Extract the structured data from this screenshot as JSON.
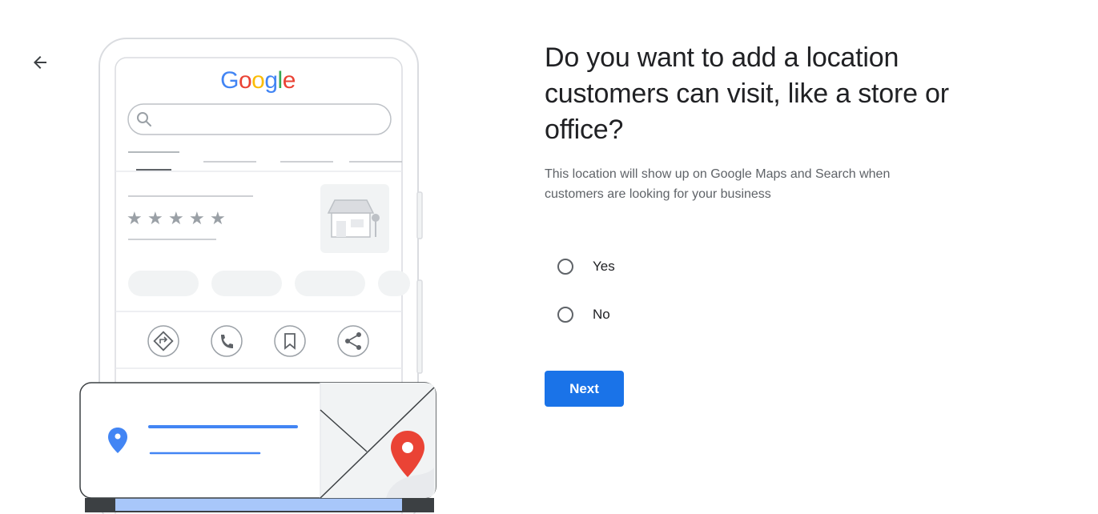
{
  "nav": {
    "back_icon": "arrow-back-icon"
  },
  "illustration": {
    "logo_text": "Google",
    "rating_icon": "star-icon",
    "rating_stars": 5,
    "action_icons": [
      "directions-icon",
      "phone-icon",
      "bookmark-icon",
      "share-icon"
    ],
    "colors": {
      "blue": "#4285f4",
      "red": "#ea4335",
      "yellow": "#fbbc05",
      "green": "#34a853",
      "grey": "#bdc1c6"
    }
  },
  "main": {
    "question": "Do you want to add a location customers can visit, like a store or office?",
    "subtitle": "This location will show up on Google Maps and Search when customers are looking for your business",
    "options": [
      {
        "label": "Yes",
        "selected": false
      },
      {
        "label": "No",
        "selected": false
      }
    ],
    "next_label": "Next",
    "accent_color": "#1a73e8"
  }
}
